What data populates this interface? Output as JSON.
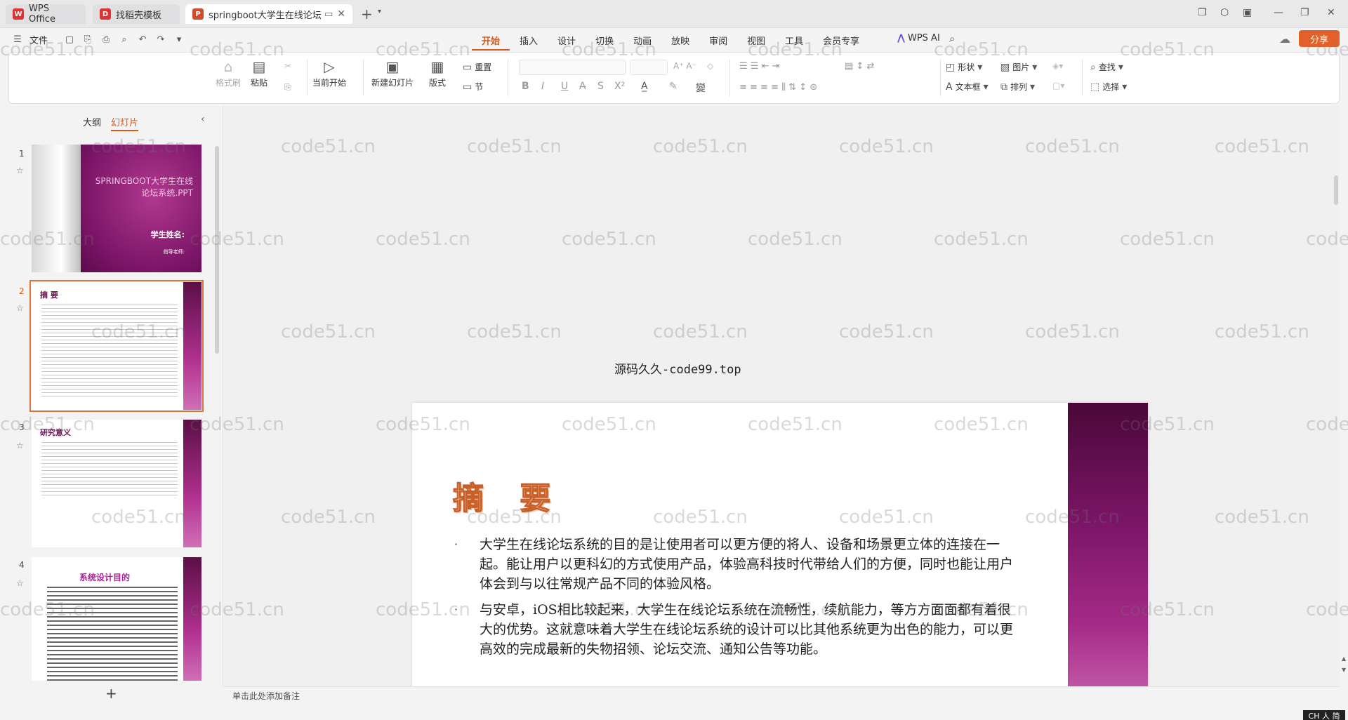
{
  "tabs": [
    {
      "label": "WPS Office",
      "logo": "W"
    },
    {
      "label": "找稻壳模板",
      "logo": "D"
    },
    {
      "label": "springboot大学生在线论坛",
      "logo": "P"
    }
  ],
  "menu": {
    "file": "文件",
    "ribbon_tabs": [
      "开始",
      "插入",
      "设计",
      "切换",
      "动画",
      "放映",
      "审阅",
      "视图",
      "工具",
      "会员专享"
    ],
    "wps_ai": "WPS AI",
    "share": "分享"
  },
  "toolbar": {
    "format_painter": "格式刷",
    "paste": "粘贴",
    "from_current": "当前开始",
    "new_slide": "新建幻灯片",
    "layout": "版式",
    "reset": "重置",
    "section": "节",
    "shape": "形状",
    "picture": "图片",
    "textbox": "文本框",
    "arrange": "排列",
    "find": "查找",
    "select": "选择"
  },
  "left_panel": {
    "tab_outline": "大纲",
    "tab_slides": "幻灯片",
    "slides": [
      {
        "num": "1",
        "title": "SPRINGBOOT大学生在线论坛系统.PPT",
        "student": "学生姓名:",
        "teacher": "指导老师:"
      },
      {
        "num": "2",
        "title": "摘 要"
      },
      {
        "num": "3",
        "title": "研究意义"
      },
      {
        "num": "4",
        "title": "系统设计目的"
      }
    ]
  },
  "canvas": {
    "notice": "源码久久-code99.top",
    "slide_title": "摘 要",
    "bullets": [
      "大学生在线论坛系统的目的是让使用者可以更方便的将人、设备和场景更立体的连接在一起。能让用户以更科幻的方式使用产品，体验高科技时代带给人们的方便，同时也能让用户体会到与以往常规产品不同的体验风格。",
      "与安卓，iOS相比较起来，大学生在线论坛系统在流畅性，续航能力，等方方面面都有着很大的优势。这就意味着大学生在线论坛系统的设计可以比其他系统更为出色的能力，可以更高效的完成最新的失物招领、论坛交流、通知公告等功能。"
    ]
  },
  "notes_placeholder": "单击此处添加备注",
  "watermark": "code51.cn",
  "ime": "CH 人 简"
}
